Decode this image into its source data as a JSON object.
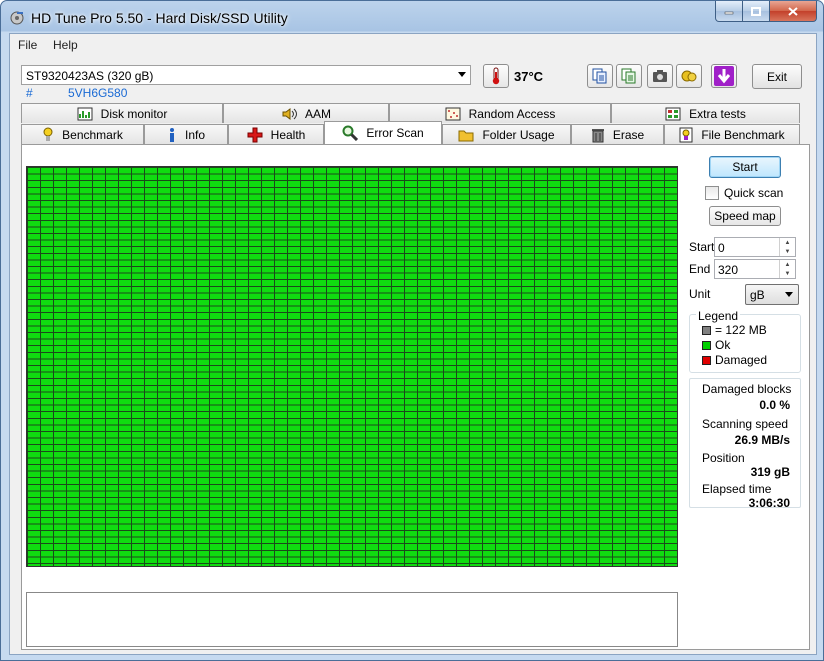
{
  "window": {
    "title": "HD Tune Pro 5.50 - Hard Disk/SSD Utility"
  },
  "menu": {
    "file": "File",
    "help": "Help"
  },
  "toolbar": {
    "drive": "ST9320423AS (320 gB)",
    "serial_prefix": "#",
    "serial": "5VH6G580",
    "temperature": "37°C",
    "exit_label": "Exit"
  },
  "tabs_top": [
    {
      "label": "Disk monitor",
      "icon": "disk-monitor-icon"
    },
    {
      "label": "AAM",
      "icon": "speaker-icon"
    },
    {
      "label": "Random Access",
      "icon": "random-access-icon"
    },
    {
      "label": "Extra tests",
      "icon": "extra-tests-icon"
    }
  ],
  "tabs_bottom": [
    {
      "label": "Benchmark",
      "icon": "benchmark-icon"
    },
    {
      "label": "Info",
      "icon": "info-icon"
    },
    {
      "label": "Health",
      "icon": "health-icon"
    },
    {
      "label": "Error Scan",
      "icon": "magnifier-icon",
      "active": true
    },
    {
      "label": "Folder Usage",
      "icon": "folder-icon"
    },
    {
      "label": "Erase",
      "icon": "trash-icon"
    },
    {
      "label": "File Benchmark",
      "icon": "file-benchmark-icon"
    }
  ],
  "scan": {
    "start_label": "Start",
    "quick_scan_label": "Quick scan",
    "quick_scan_checked": false,
    "speed_map_label": "Speed map",
    "start_field_label": "Start",
    "start_value": "0",
    "end_field_label": "End",
    "end_value": "320",
    "unit_label": "Unit",
    "unit_value": "gB"
  },
  "legend": {
    "title": "Legend",
    "block_size": "= 122 MB",
    "ok": "Ok",
    "damaged": "Damaged",
    "colors": {
      "block": "#808080",
      "ok": "#00d000",
      "damaged": "#e00000"
    }
  },
  "stats": {
    "damaged_blocks_label": "Damaged blocks",
    "damaged_blocks_value": "0.0 %",
    "scanning_speed_label": "Scanning speed",
    "scanning_speed_value": "26.9 MB/s",
    "position_label": "Position",
    "position_value": "319 gB",
    "elapsed_label": "Elapsed time",
    "elapsed_value": "3:06:30"
  },
  "grid": {
    "status": "ok",
    "color": "#00d000"
  }
}
